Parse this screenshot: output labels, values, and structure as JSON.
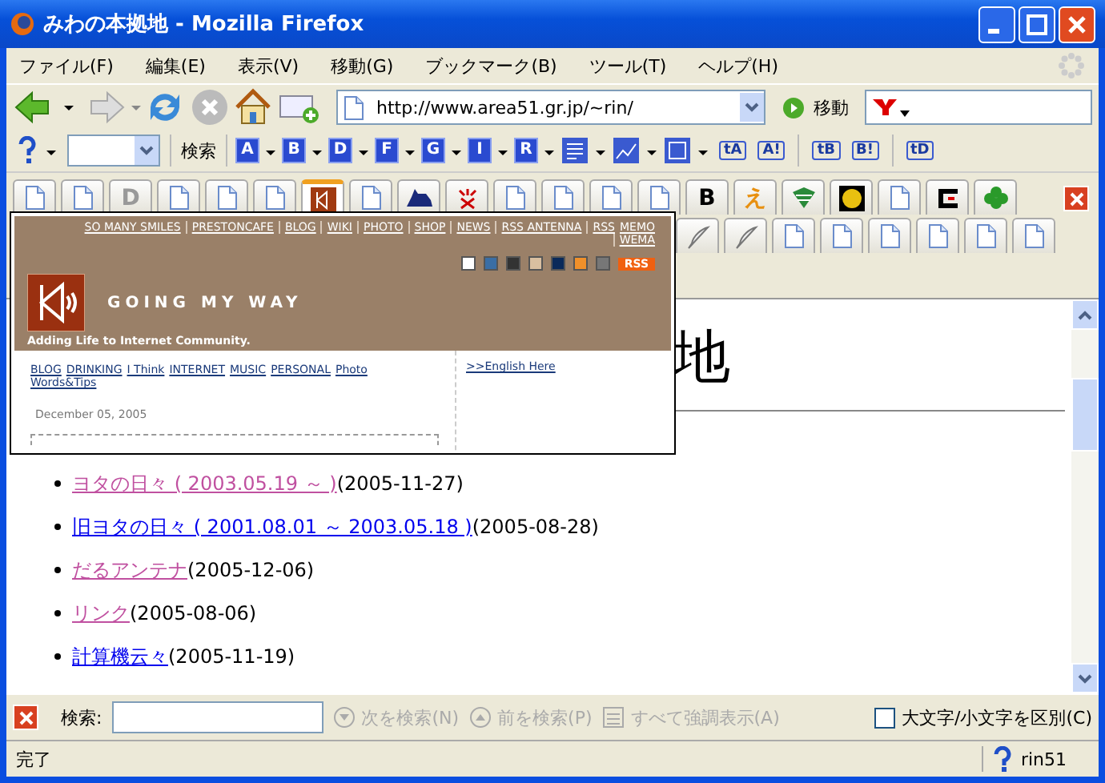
{
  "window": {
    "title": "みわの本拠地 - Mozilla Firefox"
  },
  "menu": [
    "ファイル(F)",
    "編集(E)",
    "表示(V)",
    "移動(G)",
    "ブックマーク(B)",
    "ツール(T)",
    "ヘルプ(H)"
  ],
  "nav": {
    "url": "http://www.area51.gr.jp/~rin/",
    "go": "移動"
  },
  "search_toolbar": {
    "search_button": "検索",
    "letter_buttons": [
      "A",
      "B",
      "D",
      "F",
      "G",
      "I",
      "R"
    ],
    "text_buttons": [
      "tA",
      "A!",
      "tB",
      "B!",
      "tD"
    ]
  },
  "tab_rows": [
    [
      {
        "kind": "page",
        "selected": false
      },
      {
        "kind": "page",
        "selected": false
      },
      {
        "kind": "glyph",
        "text": "D",
        "color": "#999999",
        "selected": false
      },
      {
        "kind": "page",
        "selected": false
      },
      {
        "kind": "page",
        "selected": false
      },
      {
        "kind": "page",
        "selected": false
      },
      {
        "kind": "logo",
        "selected": true
      },
      {
        "kind": "page",
        "selected": false
      },
      {
        "kind": "cat",
        "selected": false
      },
      {
        "kind": "sparkle",
        "selected": false
      },
      {
        "kind": "page",
        "selected": false
      },
      {
        "kind": "page",
        "selected": false
      },
      {
        "kind": "page",
        "selected": false
      },
      {
        "kind": "page",
        "selected": false
      },
      {
        "kind": "glyph",
        "text": "B",
        "color": "#000000",
        "selected": false
      },
      {
        "kind": "glyph",
        "text": "え",
        "color": "#e89010",
        "selected": false
      },
      {
        "kind": "stripes",
        "selected": false
      },
      {
        "kind": "coin",
        "selected": false
      },
      {
        "kind": "page",
        "selected": false
      },
      {
        "kind": "frame",
        "selected": false
      },
      {
        "kind": "clover",
        "selected": false
      }
    ],
    [
      {
        "kind": "quill",
        "selected": false
      },
      {
        "kind": "quill",
        "selected": false
      },
      {
        "kind": "page",
        "selected": false
      },
      {
        "kind": "page",
        "selected": false
      },
      {
        "kind": "page",
        "selected": false
      },
      {
        "kind": "page",
        "selected": false
      },
      {
        "kind": "page",
        "selected": false
      },
      {
        "kind": "page",
        "selected": false
      }
    ]
  ],
  "preview": {
    "nav_links": [
      "SO MANY SMILES",
      "PRESTONCAFE",
      "BLOG",
      "WIKI",
      "PHOTO",
      "SHOP",
      "NEWS",
      "RSS ANTENNA",
      "RSS",
      "MEMO",
      "WEMA"
    ],
    "swatches": [
      {
        "color": "#ffffff"
      },
      {
        "color": "#3a6ea5"
      },
      {
        "color": "#333333"
      },
      {
        "color": "#d9bfa0"
      },
      {
        "color": "#0a2a5a"
      },
      {
        "color": "#f0902a"
      },
      {
        "color": "#777777"
      }
    ],
    "rss_badge": "RSS",
    "site_title": "GOING MY WAY",
    "tagline": "Adding Life to Internet Community.",
    "categories": [
      "BLOG",
      "DRINKING",
      "I Think",
      "INTERNET",
      "MUSIC",
      "PERSONAL",
      "Photo",
      "Words&Tips"
    ],
    "date": "December 05, 2005",
    "english_link": ">>English Here"
  },
  "page": {
    "heading": "地",
    "links": [
      {
        "text": "ヨタの日々 ( 2003.05.19 ～ )",
        "date": "(2005-11-27)",
        "visited": true
      },
      {
        "text": "旧ヨタの日々 ( 2001.08.01 ～ 2003.05.18 )",
        "date": "(2005-08-28)",
        "visited": false
      },
      {
        "text": "だるアンテナ",
        "date": "(2005-12-06)",
        "visited": true
      },
      {
        "text": "リンク",
        "date": "(2005-08-06)",
        "visited": true
      },
      {
        "text": "計算機云々",
        "date": "(2005-11-19)",
        "visited": false
      }
    ]
  },
  "find_bar": {
    "label": "検索:",
    "next": "次を検索(N)",
    "previous": "前を検索(P)",
    "highlight": "すべて強調表示(A)",
    "match_case": {
      "label": "大文字/小文字を区別(C)",
      "checked": false
    }
  },
  "status_bar": {
    "text": "完了",
    "user": "rin51"
  }
}
